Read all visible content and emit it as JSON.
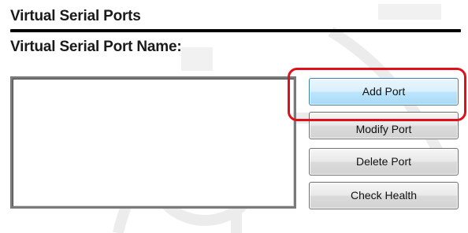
{
  "panel": {
    "title": "Virtual Serial Ports",
    "name_label": "Virtual Serial Port Name:"
  },
  "port_list": {
    "items": []
  },
  "buttons": {
    "add": "Add Port",
    "modify": "Modify Port",
    "delete": "Delete Port",
    "check_health": "Check Health"
  },
  "highlight": {
    "target": "Add Port",
    "color": "#e0101a"
  }
}
